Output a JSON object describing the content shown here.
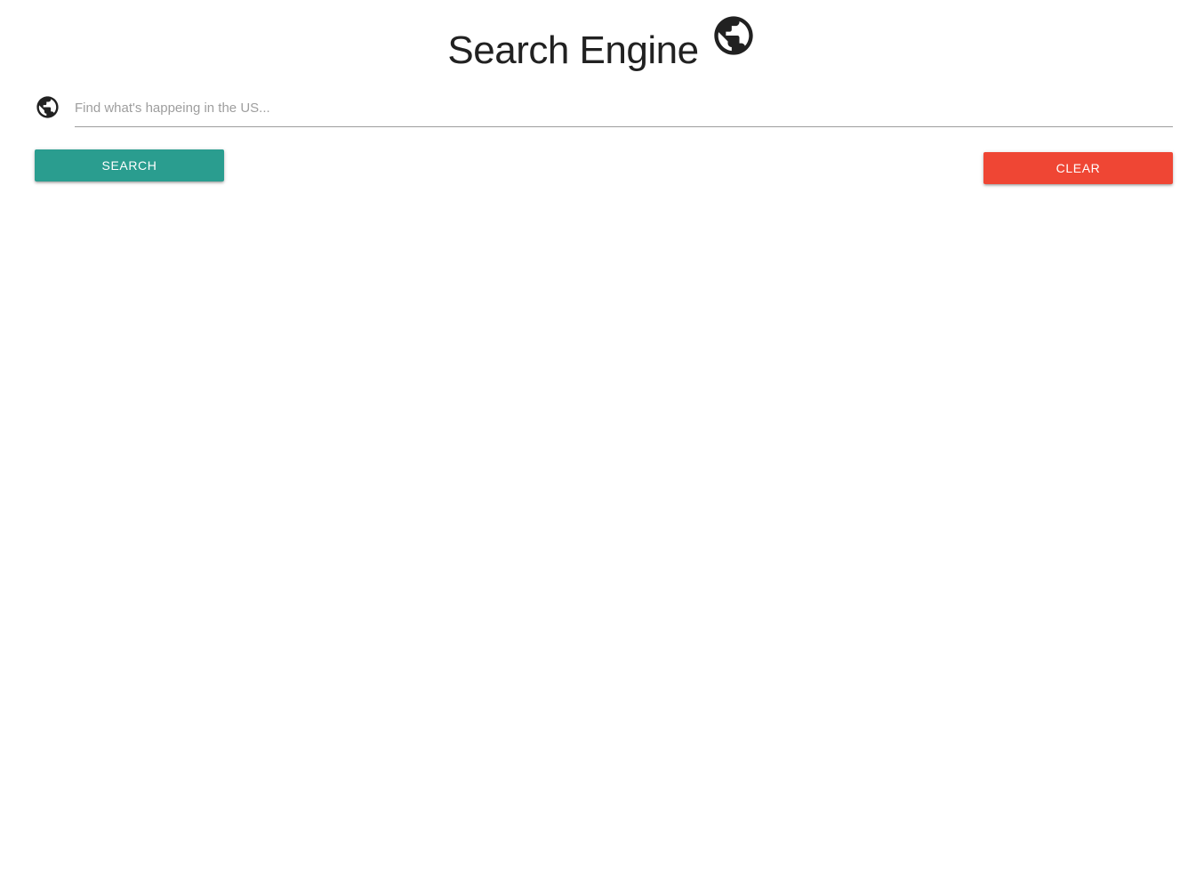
{
  "header": {
    "title": "Search Engine",
    "icon": "globe-icon"
  },
  "search": {
    "icon": "globe-icon",
    "placeholder": "Find what's happeing in the US...",
    "value": ""
  },
  "buttons": {
    "search_label": "SEARCH",
    "clear_label": "CLEAR"
  },
  "colors": {
    "search_button": "#2a9d8f",
    "clear_button": "#ef4634",
    "text": "#212121"
  }
}
